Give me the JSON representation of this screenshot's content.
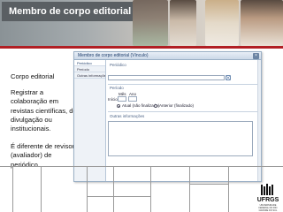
{
  "banner": {
    "title": "Membro de corpo editorial"
  },
  "side": {
    "heading": "Corpo editorial",
    "paragraph1": "Registrar a colaboração em revistas científicas, de divulgação ou institucionais.",
    "paragraph2": "É diferente de revisor (avaliador) de periódico."
  },
  "window": {
    "title": "Membro de corpo editorial (Vínculo)",
    "close_icon": "close-icon",
    "nav_items": [
      "Periódico",
      "Período",
      "Outras informações"
    ],
    "form": {
      "periodico_label": "Periódico",
      "periodo_label": "Período",
      "mes_label": "Mês",
      "ano_label": "Ano",
      "inicio_label": "Início:",
      "atual_label": "Atual (não finalizado)",
      "anterior_label": "Anterior (finalizado)",
      "outras_label": "Outras informações"
    }
  },
  "footer": {
    "logo_text": "UFRGS",
    "logo_sub": "UNIVERSIDADE FEDERAL DO RIO GRANDE DO SUL"
  },
  "colors": {
    "accent_red": "#b11f24",
    "title_box": "#5a5f63"
  }
}
